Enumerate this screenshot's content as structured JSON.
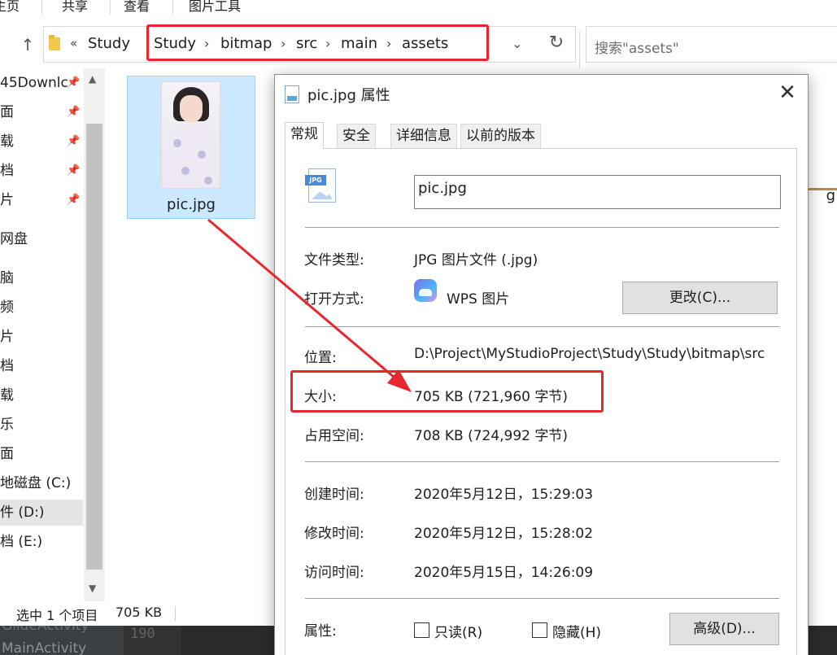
{
  "ribbon": {
    "tabs": [
      "主页",
      "共享",
      "查看",
      "图片工具"
    ]
  },
  "address_bar": {
    "overflow_glyph": "«",
    "crumbs": [
      "Study",
      "Study",
      "bitmap",
      "src",
      "main",
      "assets"
    ],
    "separator": "›",
    "dropdown_glyph": "⌄",
    "refresh_glyph": "↻",
    "up_glyph": "↑"
  },
  "search": {
    "placeholder": "搜索\"assets\""
  },
  "nav": {
    "items": [
      {
        "label": "45Downlc",
        "pinned": true
      },
      {
        "label": "面",
        "pinned": true
      },
      {
        "label": "载",
        "pinned": true
      },
      {
        "label": "档",
        "pinned": true
      },
      {
        "label": "片",
        "pinned": true
      },
      {
        "label": "网盘",
        "pinned": false
      },
      {
        "label": "脑",
        "pinned": false
      },
      {
        "label": "频",
        "pinned": false
      },
      {
        "label": "片",
        "pinned": false
      },
      {
        "label": "档",
        "pinned": false
      },
      {
        "label": "载",
        "pinned": false
      },
      {
        "label": "乐",
        "pinned": false
      },
      {
        "label": "面",
        "pinned": false
      },
      {
        "label": "地磁盘 (C:)",
        "pinned": false
      },
      {
        "label": "件 (D:)",
        "pinned": false,
        "selected": true
      },
      {
        "label": "档 (E:)",
        "pinned": false
      }
    ],
    "pin_glyph": "📌"
  },
  "content": {
    "file_name": "pic.jpg",
    "fragment": "g"
  },
  "status_bar": {
    "selection": "选中 1 个项目",
    "size": "705 KB"
  },
  "ide": {
    "line1": "GlideActivity",
    "line2": "MainActivity",
    "line_number": "190"
  },
  "dialog": {
    "title": "pic.jpg 属性",
    "close_glyph": "✕",
    "tabs": [
      "常规",
      "安全",
      "详细信息",
      "以前的版本"
    ],
    "icon_tag": "JPG",
    "file_name": "pic.jpg",
    "rows": {
      "type_label": "文件类型:",
      "type_value": "JPG 图片文件 (.jpg)",
      "open_label": "打开方式:",
      "open_value": "WPS 图片",
      "change_button": "更改(C)...",
      "location_label": "位置:",
      "location_value": "D:\\Project\\MyStudioProject\\Study\\Study\\bitmap\\src",
      "size_label": "大小:",
      "size_value": "705 KB (721,960 字节)",
      "disk_label": "占用空间:",
      "disk_value": "708 KB (724,992 字节)",
      "created_label": "创建时间:",
      "created_value": "2020年5月12日，15:29:03",
      "modified_label": "修改时间:",
      "modified_value": "2020年5月12日，15:28:02",
      "accessed_label": "访问时间:",
      "accessed_value": "2020年5月15日，14:26:09",
      "attrs_label": "属性:",
      "readonly_label": "只读(R)",
      "hidden_label": "隐藏(H)",
      "advanced_button": "高级(D)..."
    }
  },
  "colors": {
    "highlight_red": "#e8262c",
    "selection_blue": "#cce8ff"
  }
}
